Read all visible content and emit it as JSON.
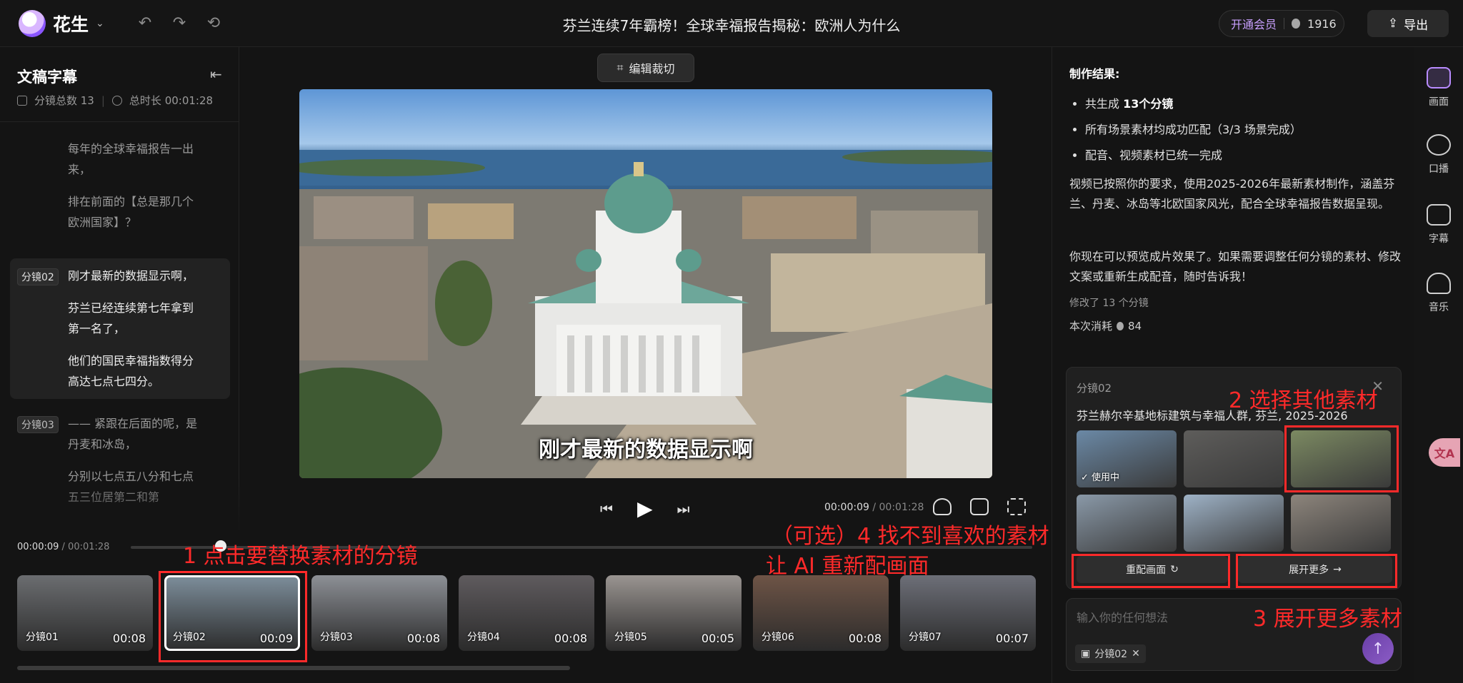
{
  "app": {
    "brand": "花生",
    "title": "芬兰连续7年霸榜！全球幸福报告揭秘：欧洲人为什么",
    "vip_label": "开通会员",
    "coins": "1916",
    "export_label": "导出"
  },
  "left": {
    "title": "文稿字幕",
    "seg_count": "分镜总数 13",
    "duration": "总时长 00:01:28",
    "segments": [
      {
        "tag": "",
        "lines": [
          "每年的全球幸福报告一出来，",
          "排在前面的【总是那几个欧洲国家】？"
        ]
      },
      {
        "tag": "分镜02",
        "lines": [
          "刚才最新的数据显示啊，",
          "芬兰已经连续第七年拿到第一名了，",
          "他们的国民幸福指数得分高达七点七四分。"
        ]
      },
      {
        "tag": "分镜03",
        "lines": [
          "—— 紧跟在后面的呢，是丹麦和冰岛，",
          "分别以七点五八分和七点五三位居第二和第"
        ]
      }
    ]
  },
  "center": {
    "crop_label": "编辑裁切",
    "subtitle": "刚才最新的数据显示啊",
    "time_current": "00:00:09",
    "time_total": "/ 00:01:28"
  },
  "timeline": {
    "time_current": "00:00:09",
    "time_total": "/ 00:01:28",
    "progress": 0.1,
    "clips": [
      {
        "name": "分镜01",
        "dur": "00:08",
        "color": "#6b6d70"
      },
      {
        "name": "分镜02",
        "dur": "00:09",
        "color": "#7e8f9c"
      },
      {
        "name": "分镜03",
        "dur": "00:08",
        "color": "#8d9096"
      },
      {
        "name": "分镜04",
        "dur": "00:08",
        "color": "#5f5b5e"
      },
      {
        "name": "分镜05",
        "dur": "00:05",
        "color": "#9a9591"
      },
      {
        "name": "分镜06",
        "dur": "00:08",
        "color": "#6e5446"
      },
      {
        "name": "分镜07",
        "dur": "00:07",
        "color": "#6d6f78"
      }
    ]
  },
  "chat": {
    "heading": "制作结果:",
    "bullets": [
      {
        "pre": "共生成 ",
        "bold": "13个分镜",
        "post": ""
      },
      {
        "pre": "所有场景素材均成功匹配（3/3 场景完成）",
        "bold": "",
        "post": ""
      },
      {
        "pre": "配音、视频素材已统一完成",
        "bold": "",
        "post": ""
      }
    ],
    "para1": "视频已按照你的要求，使用2025-2026年最新素材制作，涵盖芬兰、丹麦、冰岛等北欧国家风光，配合全球幸福报告数据呈现。",
    "para2": "你现在可以预览成片效果了。如果需要调整任何分镜的素材、修改文案或重新生成配音，随时告诉我！",
    "modified": "修改了 13 个分镜",
    "cost_label": "本次消耗",
    "cost": "84",
    "card": {
      "tag": "分镜02",
      "desc": "芬兰赫尔辛基地标建筑与幸福人群, 芬兰, 2025-2026",
      "in_use": "✓ 使用中",
      "rematch": "重配画面",
      "more": "展开更多",
      "thumb_colors": [
        "#6b89a6",
        "#5e5d5b",
        "#7c8a62",
        "#8a99a8",
        "#9eb2c6",
        "#8d857c"
      ]
    },
    "input_placeholder": "输入你的任何想法",
    "chip": "分镜02"
  },
  "rail": [
    {
      "label": "画面"
    },
    {
      "label": "口播"
    },
    {
      "label": "字幕"
    },
    {
      "label": "音乐"
    }
  ],
  "float_translate": "文A",
  "annotations": {
    "a1": "1 点击要替换素材的分镜",
    "a2": "2 选择其他素材",
    "a3": "3 展开更多素材",
    "a4_line1": "（可选）4 找不到喜欢的素材",
    "a4_line2": "让 AI 重新配画面"
  }
}
